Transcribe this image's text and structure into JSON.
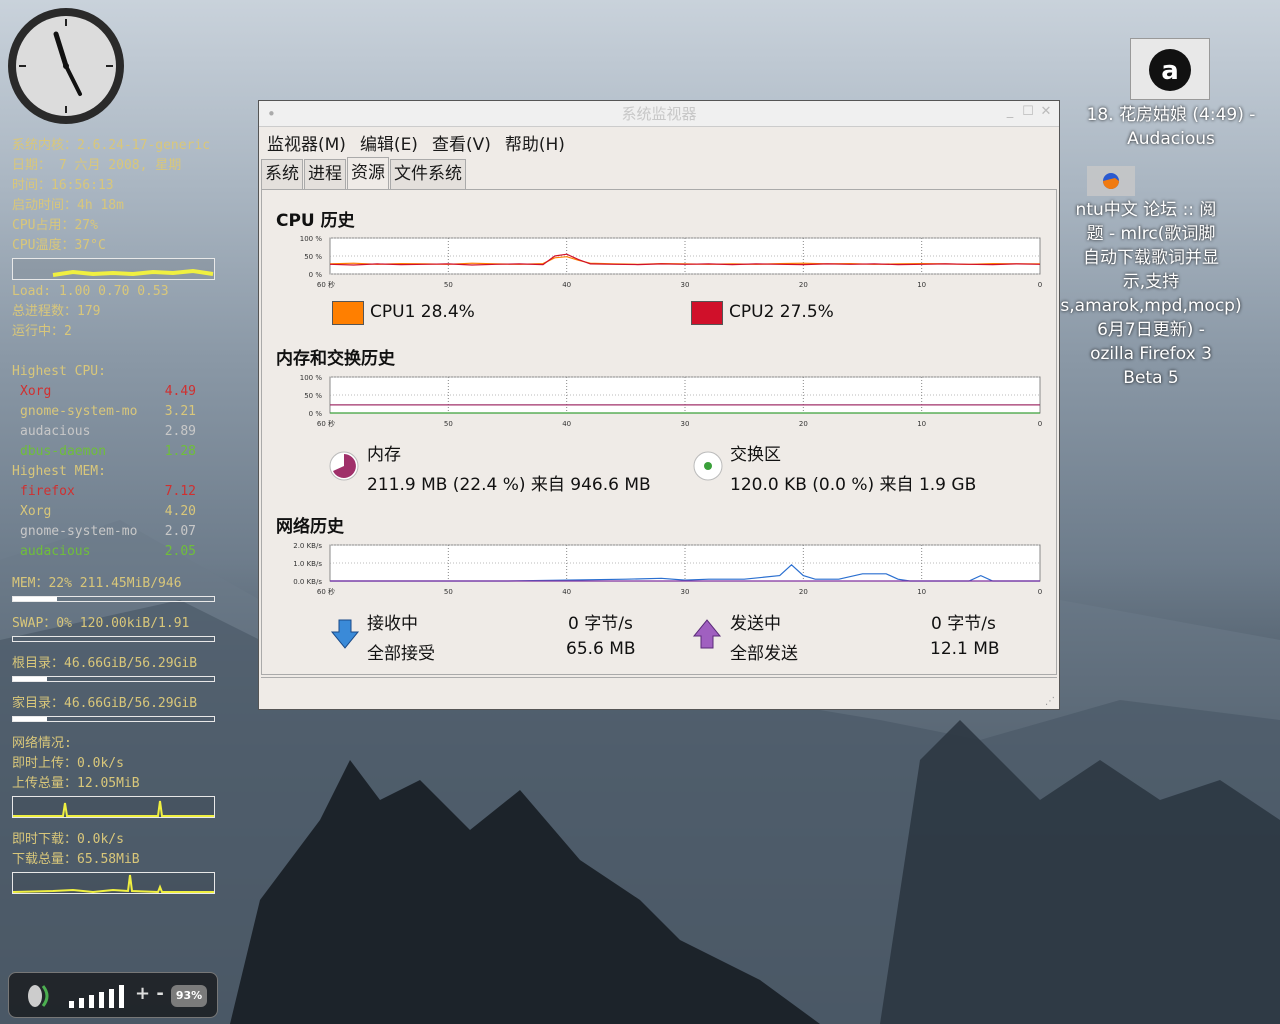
{
  "conky": {
    "kernel": "系统内核：2.6.24-17-generic",
    "date": "日期： 7 六月 2008, 星期",
    "time": "时间：16:56:13",
    "uptime": "启动时间：4h 18m",
    "cpu_usage": "CPU占用：27%",
    "cpu_temp": "CPU温度：37°C",
    "load": "Load: 1.00 0.70 0.53",
    "processes": "总进程数：179",
    "running": "运行中：2",
    "highest_cpu_title": "Highest CPU:",
    "highest_cpu": [
      {
        "name": "Xorg",
        "value": "4.49",
        "color": "#d03030"
      },
      {
        "name": "gnome-system-mo",
        "value": "3.21",
        "color": "#d9c77a"
      },
      {
        "name": "audacious",
        "value": "2.89",
        "color": "#c8c8c8"
      },
      {
        "name": "dbus-daemon",
        "value": "1.28",
        "color": "#6fbf3a"
      }
    ],
    "highest_mem_title": "Highest MEM:",
    "highest_mem": [
      {
        "name": "firefox",
        "value": "7.12",
        "color": "#d03030"
      },
      {
        "name": "Xorg",
        "value": "4.20",
        "color": "#d9c77a"
      },
      {
        "name": "gnome-system-mo",
        "value": "2.07",
        "color": "#c8c8c8"
      },
      {
        "name": "audacious",
        "value": "2.05",
        "color": "#6fbf3a"
      }
    ],
    "mem": {
      "label": "MEM：22% 211.45MiB/946",
      "fraction": 0.22
    },
    "swap": {
      "label": "SWAP：0% 120.00kiB/1.91",
      "fraction": 0.0
    },
    "root": {
      "label": "根目录：46.66GiB/56.29GiB",
      "fraction": 0.17
    },
    "home": {
      "label": "家目录：46.66GiB/56.29GiB",
      "fraction": 0.17
    },
    "net_title": "网络情况:",
    "up_rate": "即时上传：0.0k/s",
    "up_total": "上传总量：12.05MiB",
    "down_rate": "即时下载：0.0k/s",
    "down_total": "下载总量：65.58MiB"
  },
  "volume": {
    "percent_label": "93%",
    "plus_minus": "+ -"
  },
  "desktop": {
    "audacious_label_line1": "18. 花房姑娘 (4:49) -",
    "audacious_label_line2": "Audacious",
    "firefox_lines": [
      "ntu中文 论坛 :: 阅",
      "题 - mlrc(歌词脚",
      "自动下载歌词并显",
      "示,支持",
      "s,amarok,mpd,mocp)",
      "6月7日更新) -",
      "ozilla Firefox 3",
      "Beta 5"
    ]
  },
  "window": {
    "title": "系统监视器",
    "menu": [
      "监视器(M)",
      "编辑(E)",
      "查看(V)",
      "帮助(H)"
    ],
    "tabs": [
      "系统",
      "进程",
      "资源",
      "文件系统"
    ],
    "active_tab": 2,
    "cpu_title": "CPU 历史",
    "mem_title": "内存和交换历史",
    "net_title": "网络历史",
    "cpu1_label": "CPU1 28.4%",
    "cpu2_label": "CPU2 27.5%",
    "cpu1_color": "#ff7f00",
    "cpu2_color": "#d0102a",
    "mem_label": "内存",
    "mem_value": "211.9 MB (22.4 %) 来自 946.6 MB",
    "swap_label": "交换区",
    "swap_value": "120.0 KB (0.0 %) 来自 1.9 GB",
    "recv_label": "接收中",
    "recv_value": "0 字节/s",
    "recv_total_label": "全部接受",
    "recv_total_value": "65.6 MB",
    "send_label": "发送中",
    "send_value": "0 字节/s",
    "send_total_label": "全部发送",
    "send_total_value": "12.1 MB"
  },
  "chart_data": [
    {
      "type": "line",
      "title": "CPU 历史",
      "x_ticks": [
        "60 秒",
        "50",
        "40",
        "30",
        "20",
        "10",
        "0"
      ],
      "y_ticks": [
        "100 %",
        "50 %",
        "0 %"
      ],
      "ylim": [
        0,
        100
      ],
      "series": [
        {
          "name": "CPU1",
          "color": "#ff7f00",
          "x": [
            60,
            58,
            56,
            54,
            52,
            50,
            48,
            46,
            44,
            42,
            41,
            40,
            39,
            38,
            36,
            34,
            32,
            30,
            28,
            26,
            24,
            22,
            20,
            18,
            16,
            14,
            12,
            10,
            8,
            6,
            4,
            2,
            0
          ],
          "values": [
            28,
            30,
            27,
            29,
            28,
            27,
            30,
            28,
            27,
            29,
            45,
            48,
            38,
            30,
            28,
            27,
            29,
            28,
            27,
            28,
            27,
            29,
            30,
            28,
            29,
            27,
            28,
            29,
            28,
            27,
            29,
            28,
            28
          ]
        },
        {
          "name": "CPU2",
          "color": "#d0102a",
          "x": [
            60,
            58,
            56,
            54,
            52,
            50,
            48,
            46,
            44,
            42,
            41,
            40,
            39,
            38,
            36,
            34,
            32,
            30,
            28,
            26,
            24,
            22,
            20,
            18,
            16,
            14,
            12,
            10,
            8,
            6,
            4,
            2,
            0
          ],
          "values": [
            27,
            25,
            28,
            26,
            27,
            28,
            25,
            27,
            28,
            26,
            50,
            55,
            40,
            28,
            27,
            26,
            28,
            27,
            28,
            26,
            28,
            27,
            26,
            28,
            27,
            28,
            26,
            27,
            28,
            27,
            26,
            28,
            27
          ]
        }
      ]
    },
    {
      "type": "line",
      "title": "内存和交换历史",
      "x_ticks": [
        "60 秒",
        "50",
        "40",
        "30",
        "20",
        "10",
        "0"
      ],
      "y_ticks": [
        "100 %",
        "50 %",
        "0 %"
      ],
      "ylim": [
        0,
        100
      ],
      "series": [
        {
          "name": "内存",
          "color": "#a0306a",
          "x": [
            60,
            0
          ],
          "values": [
            22.4,
            22.4
          ]
        },
        {
          "name": "交换区",
          "color": "#3aa03a",
          "x": [
            60,
            0
          ],
          "values": [
            0,
            0
          ]
        }
      ]
    },
    {
      "type": "line",
      "title": "网络历史",
      "x_ticks": [
        "60 秒",
        "50",
        "40",
        "30",
        "20",
        "10",
        "0"
      ],
      "y_ticks": [
        "2.0 KB/s",
        "1.0 KB/s",
        "0.0 KB/s"
      ],
      "ylim": [
        0,
        2.0
      ],
      "series": [
        {
          "name": "接收中",
          "color": "#2a6fd0",
          "x": [
            60,
            55,
            50,
            45,
            40,
            35,
            32,
            30,
            28,
            25,
            22,
            21,
            20,
            19,
            17,
            15,
            13,
            12,
            11,
            10,
            8,
            6,
            5,
            4,
            0
          ],
          "values": [
            0,
            0,
            0,
            0,
            0.05,
            0.1,
            0.15,
            0.05,
            0.1,
            0.1,
            0.3,
            0.9,
            0.3,
            0.1,
            0.1,
            0.4,
            0.4,
            0.1,
            0,
            0,
            0,
            0,
            0.3,
            0,
            0
          ]
        },
        {
          "name": "发送中",
          "color": "#8030a0",
          "x": [
            60,
            0
          ],
          "values": [
            0,
            0
          ]
        }
      ]
    }
  ]
}
